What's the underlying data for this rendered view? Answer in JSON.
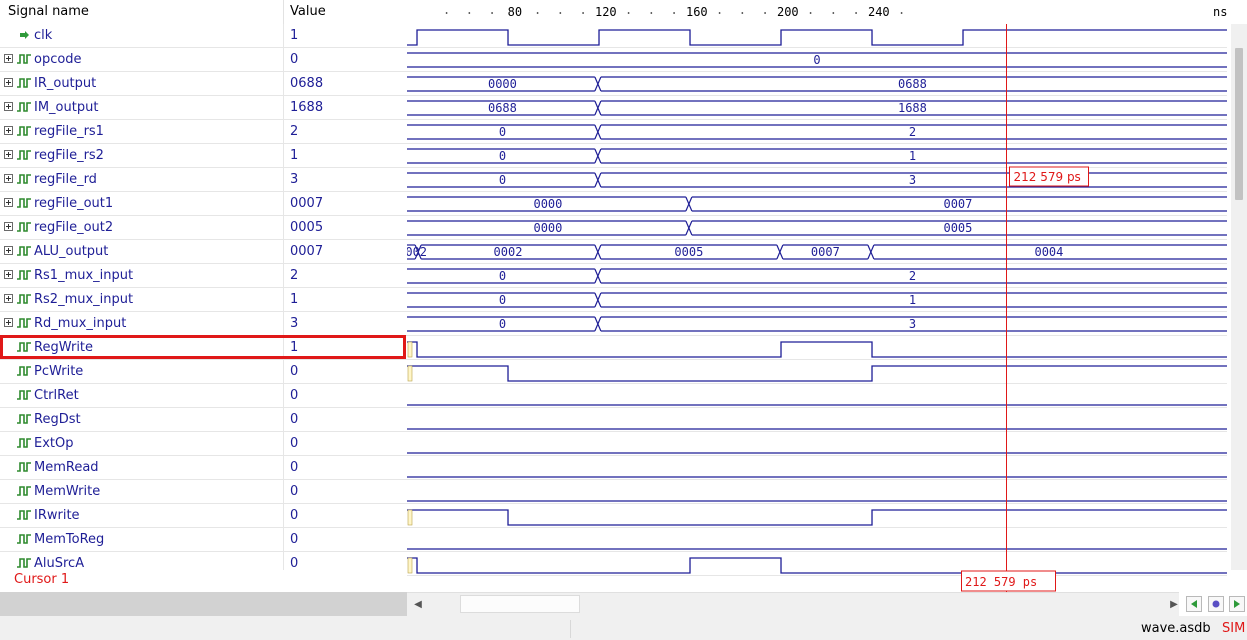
{
  "header": {
    "signal_col": "Signal name",
    "value_col": "Value",
    "time_unit": "ns"
  },
  "timeline": {
    "ticks": [
      "80",
      "120",
      "160",
      "200",
      "240"
    ]
  },
  "signals": [
    {
      "name": "clk",
      "value": "1",
      "kind": "clock",
      "expandable": false
    },
    {
      "name": "opcode",
      "value": "0",
      "kind": "bus",
      "expandable": true
    },
    {
      "name": "IR_output",
      "value": "0688",
      "kind": "bus",
      "expandable": true
    },
    {
      "name": "IM_output",
      "value": "1688",
      "kind": "bus",
      "expandable": true
    },
    {
      "name": "regFile_rs1",
      "value": "2",
      "kind": "bus",
      "expandable": true
    },
    {
      "name": "regFile_rs2",
      "value": "1",
      "kind": "bus",
      "expandable": true
    },
    {
      "name": "regFile_rd",
      "value": "3",
      "kind": "bus",
      "expandable": true
    },
    {
      "name": "regFile_out1",
      "value": "0007",
      "kind": "bus",
      "expandable": true
    },
    {
      "name": "regFile_out2",
      "value": "0005",
      "kind": "bus",
      "expandable": true
    },
    {
      "name": "ALU_output",
      "value": "0007",
      "kind": "bus",
      "expandable": true
    },
    {
      "name": "Rs1_mux_input",
      "value": "2",
      "kind": "bus",
      "expandable": true
    },
    {
      "name": "Rs2_mux_input",
      "value": "1",
      "kind": "bus",
      "expandable": true
    },
    {
      "name": "Rd_mux_input",
      "value": "3",
      "kind": "bus",
      "expandable": true
    },
    {
      "name": "RegWrite",
      "value": "1",
      "kind": "bit",
      "expandable": false,
      "highlighted": true
    },
    {
      "name": "PcWrite",
      "value": "0",
      "kind": "bit",
      "expandable": false
    },
    {
      "name": "CtrlRet",
      "value": "0",
      "kind": "bit",
      "expandable": false
    },
    {
      "name": "RegDst",
      "value": "0",
      "kind": "bit",
      "expandable": false
    },
    {
      "name": "ExtOp",
      "value": "0",
      "kind": "bit",
      "expandable": false
    },
    {
      "name": "MemRead",
      "value": "0",
      "kind": "bit",
      "expandable": false
    },
    {
      "name": "MemWrite",
      "value": "0",
      "kind": "bit",
      "expandable": false
    },
    {
      "name": "IRwrite",
      "value": "0",
      "kind": "bit",
      "expandable": false
    },
    {
      "name": "MemToReg",
      "value": "0",
      "kind": "bit",
      "expandable": false
    },
    {
      "name": "AluSrcA",
      "value": "0",
      "kind": "bit",
      "expandable": false
    }
  ],
  "waveforms": {
    "opcode": [
      "0"
    ],
    "IR_output": [
      "0000",
      "0688"
    ],
    "IM_output": [
      "0688",
      "1688"
    ],
    "regFile_rs1": [
      "0",
      "2"
    ],
    "regFile_rs2": [
      "0",
      "1"
    ],
    "regFile_rd": [
      "0",
      "3"
    ],
    "regFile_out1": [
      "0000",
      "0007"
    ],
    "regFile_out2": [
      "0000",
      "0005"
    ],
    "ALU_output": [
      "0002",
      "0002",
      "0005",
      "0007",
      "0004"
    ],
    "Rs1_mux_input": [
      "0",
      "2"
    ],
    "Rs2_mux_input": [
      "0",
      "1"
    ],
    "Rd_mux_input": [
      "0",
      "3"
    ]
  },
  "cursor": {
    "label": "Cursor 1",
    "time_readout": "212 579 ps",
    "flag_readout": "212 579 ps"
  },
  "statusbar": {
    "file": "wave.asdb",
    "mode": "SIM"
  },
  "colors": {
    "trace": "#1e1e96",
    "cursor": "#e01818",
    "clock_icon": "#2e9a3a",
    "highlight": "#e01818"
  }
}
